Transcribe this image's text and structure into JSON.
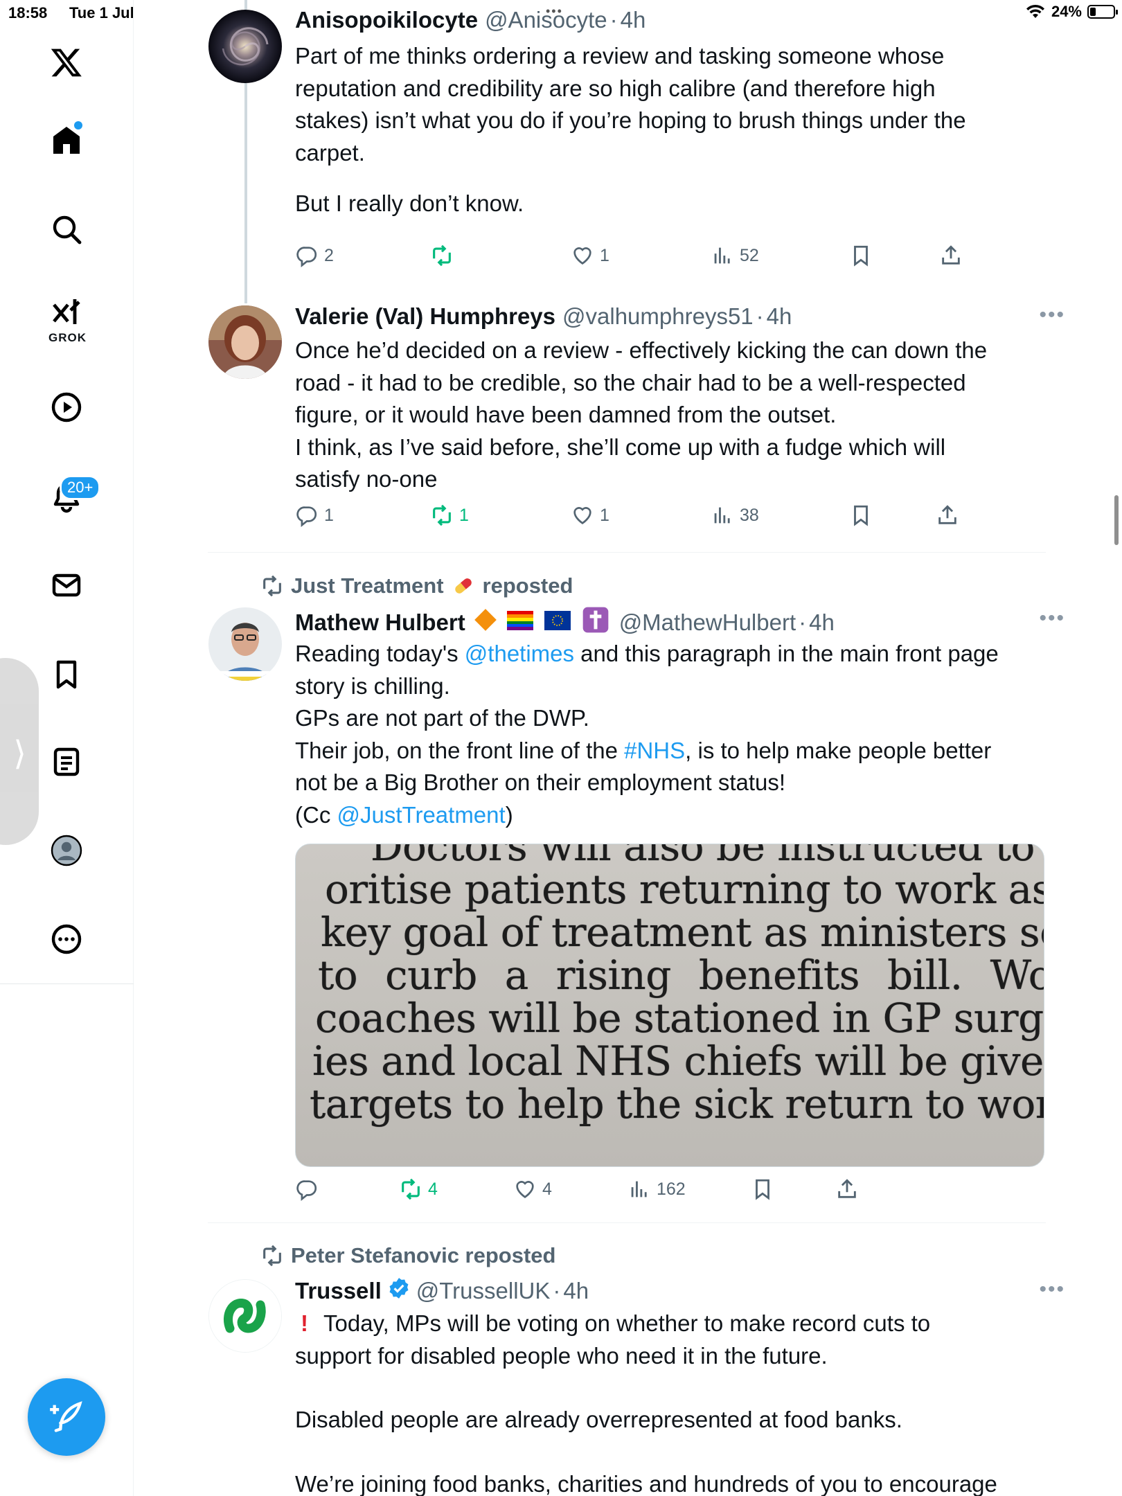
{
  "status_bar": {
    "time": "18:58",
    "date": "Tue 1 Jul",
    "battery_percent": "24%",
    "battery_level": 0.24,
    "icons": [
      "wifi-icon",
      "battery-icon"
    ]
  },
  "sidebar": {
    "items": [
      {
        "name": "x-logo-icon"
      },
      {
        "name": "home-icon",
        "has_dot": true
      },
      {
        "name": "search-icon"
      },
      {
        "name": "grok-icon",
        "label": "GROK"
      },
      {
        "name": "video-icon"
      },
      {
        "name": "notifications-icon",
        "badge": "20+"
      },
      {
        "name": "messages-icon"
      },
      {
        "name": "bookmarks-icon"
      },
      {
        "name": "lists-icon"
      },
      {
        "name": "profile-icon"
      },
      {
        "name": "more-icon"
      }
    ],
    "compose_icon": "compose-icon"
  },
  "tweets": [
    {
      "name": "Anisopoikilocyte",
      "handle": "@Anisocyte",
      "time": "4h",
      "body": [
        "Part of me thinks ordering a review and tasking someone whose",
        "reputation and credibility are so high calibre (and therefore high",
        "stakes) isn’t what you do if you’re hoping to brush things under the",
        "carpet.",
        "",
        "But I really don’t know."
      ],
      "replies": "2",
      "reposts": "",
      "likes": "1",
      "views": "52"
    },
    {
      "name": "Valerie (Val) Humphreys",
      "handle": "@valhumphreys51",
      "time": "4h",
      "body": [
        "Once he’d decided on a review - effectively kicking the can down the",
        "road - it had to be credible, so the chair had to be a well-respected",
        "figure, or it would have been damned from the outset.",
        "I think, as I’ve said before, she’ll come up with a fudge which will",
        "satisfy no-one"
      ],
      "replies": "1",
      "reposts": "1",
      "likes": "1",
      "views": "38"
    },
    {
      "reposted_by": "Just Treatment",
      "reposted_suffix": "reposted",
      "name": "Mathew Hulbert",
      "handle": "@MathewHulbert",
      "time": "4h",
      "body_lines": [
        {
          "pre": "Reading today's ",
          "link": "@thetimes",
          "post": " and this paragraph in the main front page"
        },
        {
          "pre": "story is chilling.",
          "link": "",
          "post": ""
        },
        {
          "pre": "GPs are not part of the DWP.",
          "link": "",
          "post": ""
        },
        {
          "pre": "Their job, on the front line of the ",
          "link": "#NHS",
          "post": ", is to help make people better"
        },
        {
          "pre": "not be a Big Brother on their employment status!",
          "link": "",
          "post": ""
        },
        {
          "pre": "(Cc ",
          "link": "@JustTreatment",
          "post": ")"
        }
      ],
      "media_text": [
        "Doctors will also be instructed to pri-",
        "oritise patients returning to work as a",
        "key goal of treatment as ministers seek",
        "to curb a rising benefits bill. Work",
        "coaches will be stationed in GP surger-",
        "ies and local NHS chiefs will be given",
        "targets to help the sick return to work."
      ],
      "replies": "",
      "reposts": "4",
      "likes": "4",
      "views": "162"
    },
    {
      "reposted_by": "Peter Stefanovic reposted",
      "name": "Trussell",
      "handle": "@TrussellUK",
      "time": "4h",
      "body_first": "Today, MPs will be voting on whether to make record cuts to",
      "body": [
        "support for disabled people who need it in the future.",
        "",
        "Disabled people are already overrepresented at food banks.",
        "",
        "We’re joining food banks, charities and hundreds of you to encourage"
      ]
    }
  ],
  "colors": {
    "accent": "#1d9bf0",
    "repost_green": "#00ba7c",
    "secondary_text": "#536471",
    "trussell_green": "#1aa34a"
  }
}
